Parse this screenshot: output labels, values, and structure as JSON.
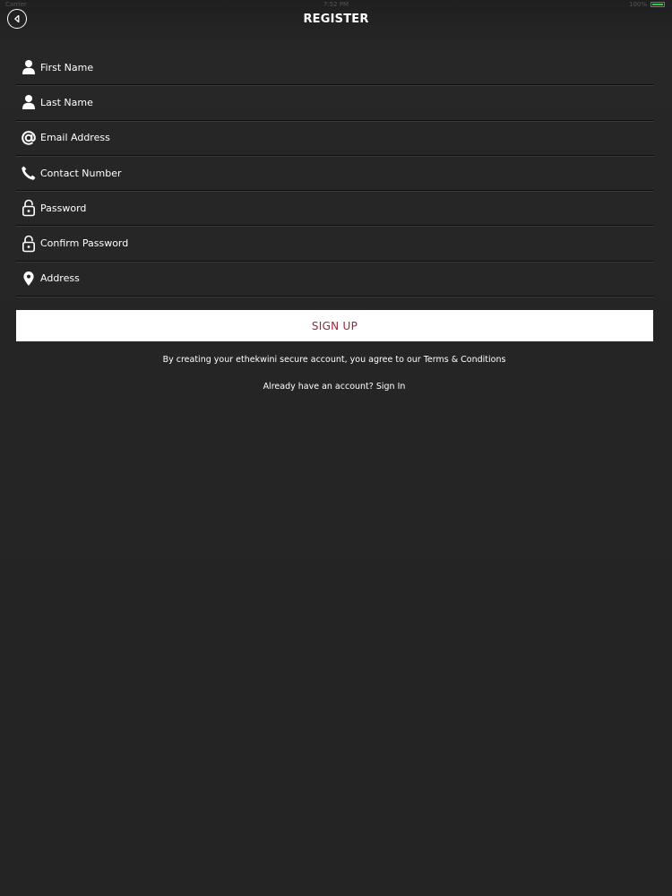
{
  "status_bar": {
    "carrier": "Carrier",
    "time": "7:52 PM",
    "battery_text": "100%",
    "battery_level": 1.0,
    "battery_color": "#33cc44"
  },
  "header": {
    "title": "REGISTER",
    "back_icon": "back-circle-icon"
  },
  "form": {
    "fields": [
      {
        "placeholder": "First Name",
        "icon": "user-icon",
        "type": "text"
      },
      {
        "placeholder": "Last Name",
        "icon": "user-icon",
        "type": "text"
      },
      {
        "placeholder": "Email Address",
        "icon": "at-icon",
        "type": "email"
      },
      {
        "placeholder": "Contact Number",
        "icon": "phone-icon",
        "type": "tel"
      },
      {
        "placeholder": "Password",
        "icon": "lock-icon",
        "type": "password"
      },
      {
        "placeholder": "Confirm Password",
        "icon": "lock-icon",
        "type": "password"
      },
      {
        "placeholder": "Address",
        "icon": "location-pin-icon",
        "type": "text"
      }
    ]
  },
  "signup": {
    "label": "SIGN UP",
    "text_color": "#9a2434"
  },
  "terms": {
    "prefix": "By creating your ethekwini secure account, you agree to our ",
    "link": "Terms & Conditions"
  },
  "signin": {
    "prefix": "Already have an account? ",
    "link": "Sign In"
  }
}
